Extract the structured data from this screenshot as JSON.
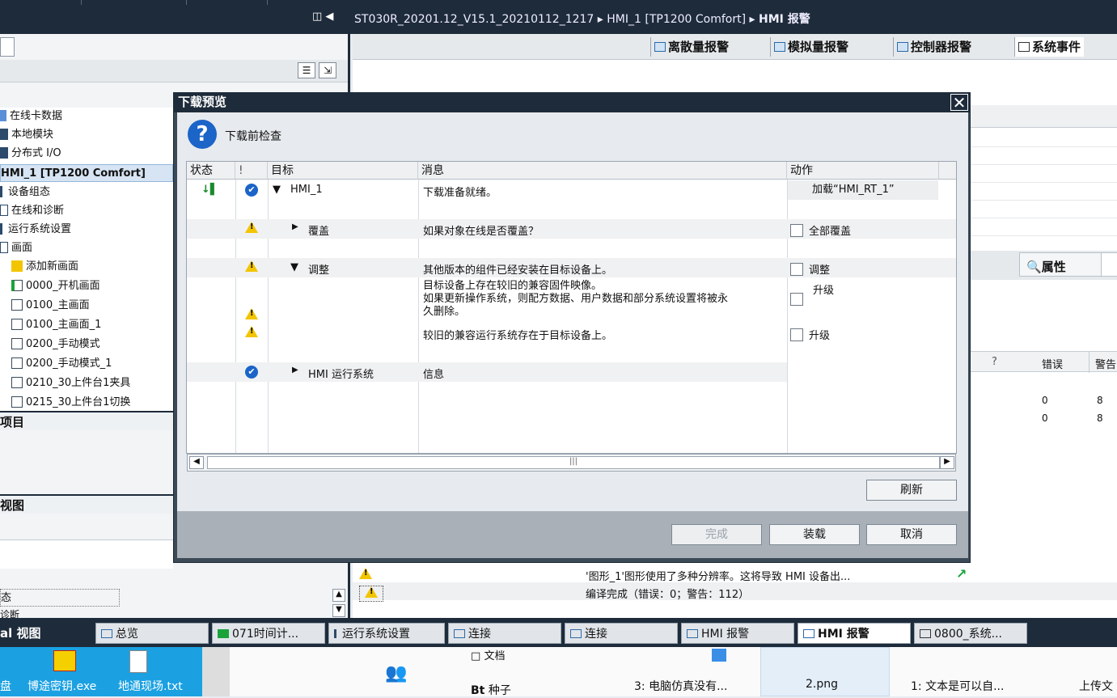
{
  "breadcrumb": {
    "project": "ST030R_20201.12_V15.1_20210112_1217",
    "device": "HMI_1 [TP1200 Comfort]",
    "page": "HMI 报警",
    "sep": "▸"
  },
  "right_tabs": [
    "离散量报警",
    "模拟量报警",
    "控制器报警",
    "系统事件"
  ],
  "left_tree": [
    {
      "label": "在线卡数据",
      "icon": "card-icon"
    },
    {
      "label": "本地模块",
      "icon": "module-icon"
    },
    {
      "label": "分布式 I/O",
      "icon": "io-icon"
    },
    {
      "label": "HMI_1 [TP1200 Comfort]",
      "icon": "",
      "selected": true
    },
    {
      "label": "设备组态",
      "icon": "wrench-icon"
    },
    {
      "label": "在线和诊断",
      "icon": "diag-icon"
    },
    {
      "label": "运行系统设置",
      "icon": "wrench-icon"
    },
    {
      "label": "画面",
      "icon": "folder-icon"
    },
    {
      "label": "添加新画面",
      "icon": "add-icon"
    },
    {
      "label": "0000_开机画面",
      "icon": "page-icon"
    },
    {
      "label": "0100_主画面",
      "icon": "page-icon"
    },
    {
      "label": "0100_主画面_1",
      "icon": "page-icon"
    },
    {
      "label": "0200_手动模式",
      "icon": "page-icon"
    },
    {
      "label": "0200_手动模式_1",
      "icon": "page-icon"
    },
    {
      "label": "0210_30上件台1夹具",
      "icon": "page-icon"
    },
    {
      "label": "0215_30上件台1切换",
      "icon": "page-icon"
    }
  ],
  "left_sections": {
    "details": "项目",
    "view": "视图",
    "status": "态",
    "diag": "诊断"
  },
  "dialog": {
    "title": "下载预览",
    "subtitle": "下载前检查",
    "columns": [
      "状态",
      "!",
      "目标",
      "消息",
      "动作"
    ],
    "rows": [
      {
        "target": "HMI_1",
        "message": "下载准备就绪。",
        "action": "加载“HMI_RT_1”"
      },
      {
        "target": "覆盖",
        "message": "如果对象在线是否覆盖？",
        "action": "全部覆盖"
      },
      {
        "target": "调整",
        "message": "其他版本的组件已经安装在目标设备上。",
        "action": "调整"
      },
      {
        "target": "",
        "message1": "目标设备上存在较旧的兼容固件映像。",
        "message2": "如果更新操作系统，则配方数据、用户数据和部分系统设置将被永",
        "message3": "久删除。",
        "action": "升级"
      },
      {
        "target": "",
        "message": "较旧的兼容运行系统存在于目标设备上。",
        "action": "升级"
      },
      {
        "target": "HMI 运行系统",
        "message": "信息",
        "action": ""
      }
    ],
    "refresh": "刷新",
    "finish": "完成",
    "load": "装载",
    "cancel": "取消"
  },
  "right_panel": {
    "properties": "属性",
    "q": "?",
    "errors": "错误",
    "warnings": "警告",
    "r1_err": "0",
    "r1_warn": "8",
    "r2_err": "0",
    "r2_warn": "8"
  },
  "bottom_messages": [
    "'图形_1'图形使用了多种分辨率。这将导致 HMI 设备出...",
    "编译完成（错误：0；警告：112）"
  ],
  "taskbar": [
    "al 视图",
    "总览",
    "071时间计...",
    "运行系统设置",
    "连接",
    "连接",
    "HMI 报警",
    "HMI 报警",
    "0800_系统..."
  ],
  "desktop": [
    "盘",
    "博途密钥.exe",
    "地通现场.txt",
    "文档",
    "种子",
    "3: 电脑仿真没有...",
    "2.png",
    "1: 文本是可以自...",
    "上传文"
  ],
  "desktop_bt": "Bt"
}
